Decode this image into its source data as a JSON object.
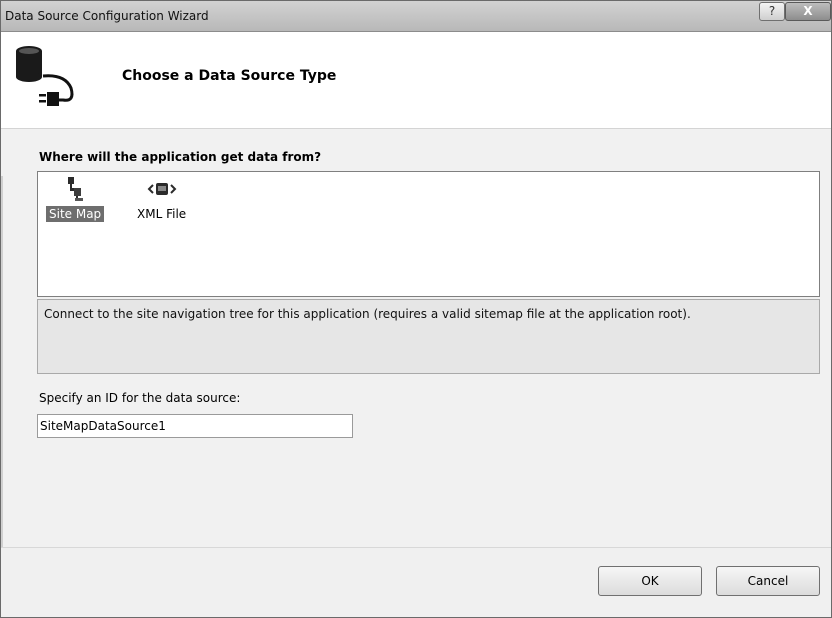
{
  "window": {
    "title": "Data Source Configuration Wizard",
    "help_label": "?",
    "close_label": "X"
  },
  "header": {
    "title": "Choose a Data Source Type",
    "icon": "database-plug-icon"
  },
  "sources": {
    "question": "Where will the application get data from?",
    "items": [
      {
        "label": "Site Map",
        "icon": "sitemap-icon",
        "selected": true
      },
      {
        "label": "XML File",
        "icon": "xml-file-icon",
        "selected": false
      }
    ],
    "description": "Connect to the site navigation tree for this application (requires a valid sitemap file at the application root)."
  },
  "id_field": {
    "label": "Specify an ID for the data source:",
    "value": "SiteMapDataSource1"
  },
  "buttons": {
    "ok": "OK",
    "cancel": "Cancel"
  }
}
